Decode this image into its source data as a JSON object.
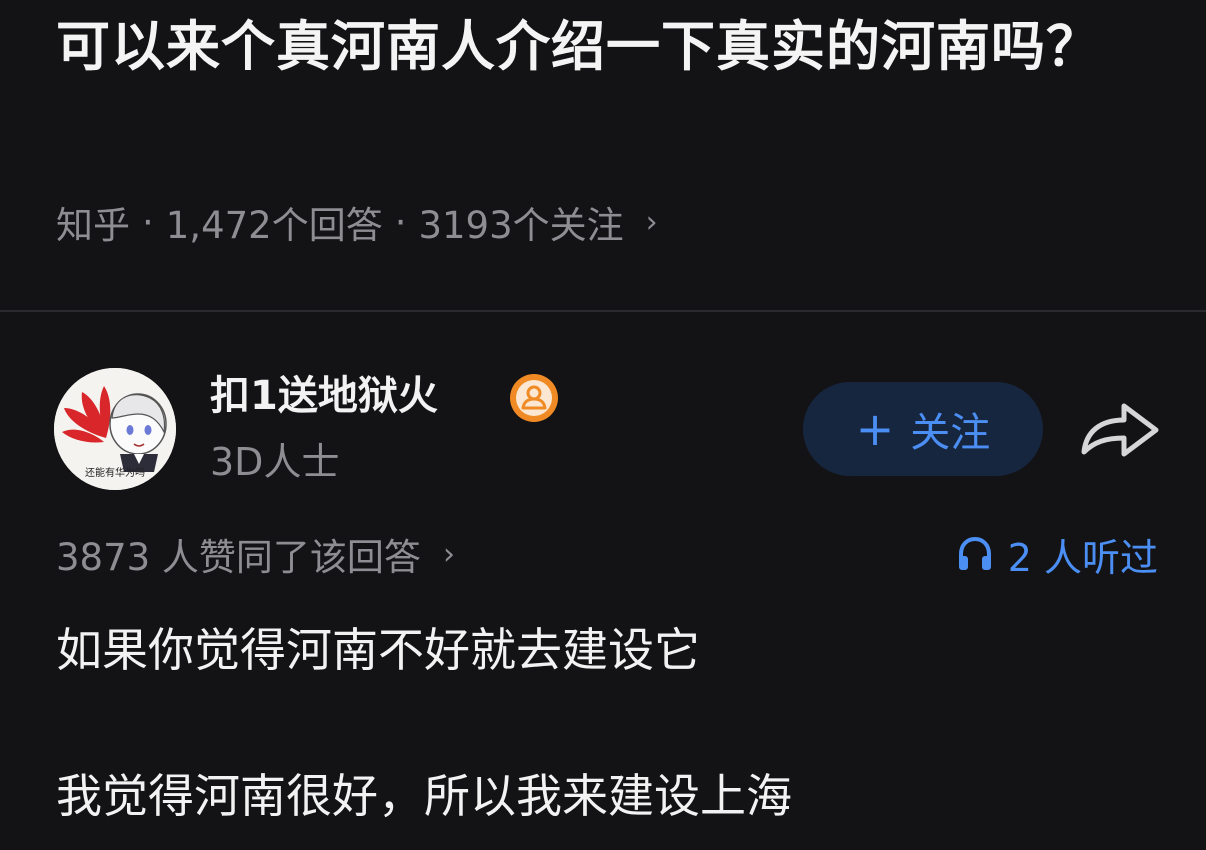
{
  "question": {
    "title": "可以来个真河南人介绍一下真实的河南吗？",
    "source": "知乎",
    "separator": "·",
    "answers": "1,472个回答",
    "followers": "3193个关注",
    "chevron": "›"
  },
  "author": {
    "name": "扣1送地狱火",
    "bio": "3D人士",
    "avatar_icon": "avatar-image",
    "badge_icon": "verified-user-badge-icon",
    "badge_color": "#f08a24"
  },
  "actions": {
    "follow_plus": "+",
    "follow_label": "关注",
    "share_icon": "share-arrow-icon"
  },
  "answer": {
    "votes": "3873 人赞同了该回答",
    "votes_chevron": "›",
    "listened": "2 人听过",
    "listen_icon": "headphones-icon",
    "paragraphs": [
      "如果你觉得河南不好就去建设它",
      "我觉得河南很好，所以我来建设上海"
    ]
  },
  "colors": {
    "background": "#131316",
    "accent": "#4c8ff4",
    "muted_text": "#8d8d92",
    "follow_button_bg": "#17263f"
  }
}
